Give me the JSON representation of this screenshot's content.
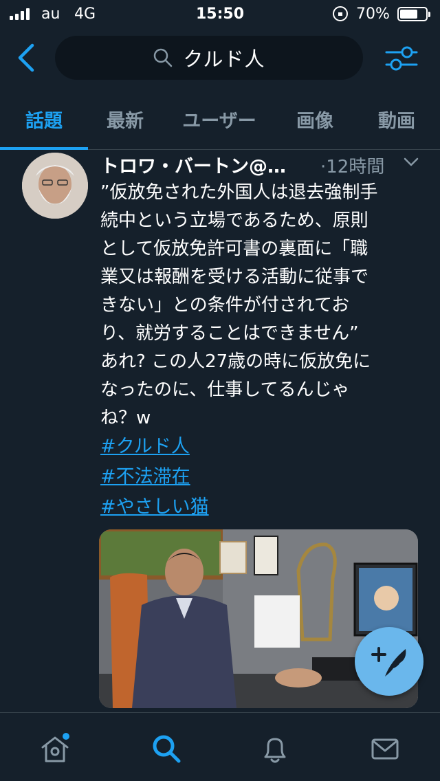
{
  "status_bar": {
    "carrier": "au",
    "network": "4G",
    "time": "15:50",
    "battery_percent": "70%",
    "battery_level": 0.7
  },
  "search": {
    "query": "クルド人"
  },
  "tabs": [
    {
      "label": "話題",
      "active": true
    },
    {
      "label": "最新",
      "active": false
    },
    {
      "label": "ユーザー",
      "active": false
    },
    {
      "label": "画像",
      "active": false
    },
    {
      "label": "動画",
      "active": false
    }
  ],
  "tweet": {
    "author": "トロワ・バートン@…",
    "time": "·12時間",
    "lines": [
      "”仮放免された外国人は退去強制手",
      "続中という立場であるため、原則",
      "として仮放免許可書の裏面に「職",
      "業又は報酬を受ける活動に従事で",
      "きない」との条件が付されてお",
      "り、就労することはできません”",
      "あれ? この人27歳の時に仮放免に",
      "なったのに、仕事してるんじゃ",
      "ね？w"
    ],
    "hashtags": [
      "#クルド人",
      "#不法滞在",
      "#やさしい猫"
    ]
  },
  "colors": {
    "background": "#15202b",
    "accent": "#1da1f2",
    "muted": "#8899a6",
    "fab": "#6ab7ec"
  },
  "icons": {
    "back": "chevron-left-icon",
    "search": "search-icon",
    "filter": "sliders-icon",
    "compose": "feather-plus-icon",
    "home": "home-icon",
    "explore": "search-icon",
    "notifications": "bell-icon",
    "messages": "envelope-icon"
  }
}
